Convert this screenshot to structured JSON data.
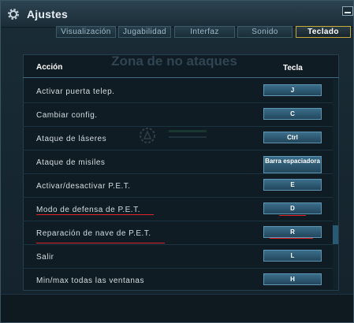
{
  "window": {
    "title": "Ajustes",
    "icons": {
      "settings": "gear-icon",
      "minimize": "minimize-icon"
    }
  },
  "tabs": [
    {
      "label": "Visualización",
      "active": false
    },
    {
      "label": "Jugabilidad",
      "active": false
    },
    {
      "label": "Interfaz",
      "active": false
    },
    {
      "label": "Sonido",
      "active": false
    },
    {
      "label": "Teclado",
      "active": true
    }
  ],
  "background_heading": "Zona de no ataques",
  "table": {
    "headers": {
      "action": "Acción",
      "key": "Tecla"
    },
    "rows": [
      {
        "action": "Activar puerta telep.",
        "key": "J"
      },
      {
        "action": "Cambiar config.",
        "key": "C"
      },
      {
        "action": "Ataque de láseres",
        "key": "Ctrl"
      },
      {
        "action": "Ataque de misiles",
        "key": "Barra espaciadora"
      },
      {
        "action": "Activar/desactivar P.E.T.",
        "key": "E"
      },
      {
        "action": "Modo de defensa de P.E.T.",
        "key": "D",
        "highlighted": true
      },
      {
        "action": "Reparación de nave de P.E.T.",
        "key": "R",
        "highlighted": true
      },
      {
        "action": "Salir",
        "key": "L"
      },
      {
        "action": "Min/max todas las ventanas",
        "key": "H"
      }
    ]
  },
  "colors": {
    "accent_active_tab": "#c7a83a",
    "key_button": "#2f5a73",
    "highlight_underline": "#e0242a"
  }
}
